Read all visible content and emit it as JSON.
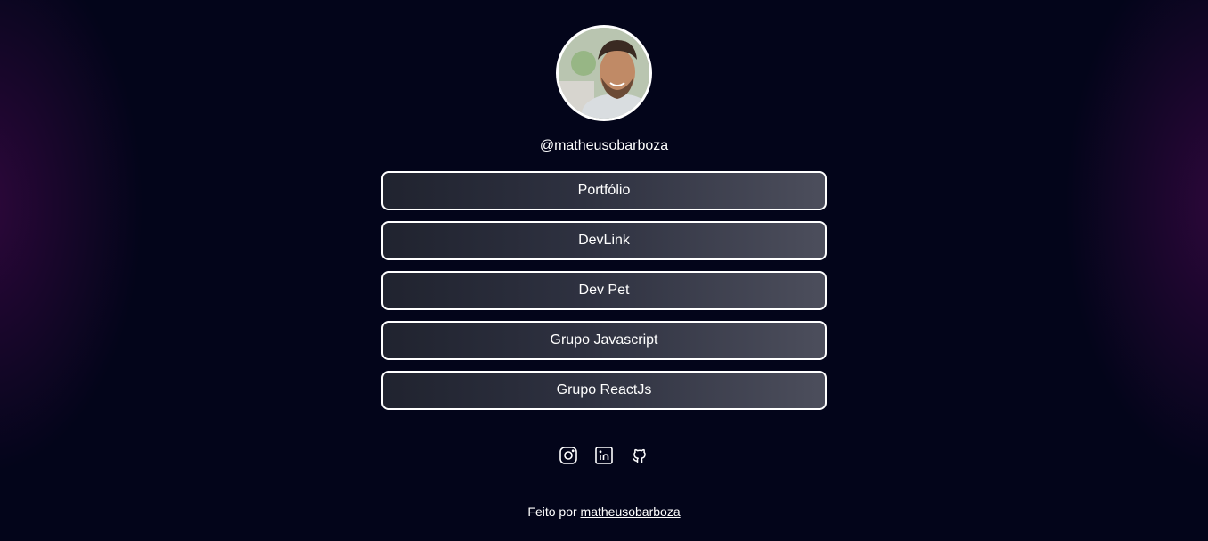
{
  "profile": {
    "username": "@matheusobarboza",
    "avatar_icon": "profile-photo"
  },
  "links": [
    {
      "label": "Portfólio"
    },
    {
      "label": "DevLink"
    },
    {
      "label": "Dev Pet"
    },
    {
      "label": "Grupo Javascript"
    },
    {
      "label": "Grupo ReactJs"
    }
  ],
  "socials": [
    {
      "icon": "instagram-icon"
    },
    {
      "icon": "linkedin-icon"
    },
    {
      "icon": "github-icon"
    }
  ],
  "footer": {
    "prefix": "Feito por",
    "author": "matheusobarboza"
  },
  "colors": {
    "background": "#03051a",
    "glow": "#3c0846",
    "button_start": "#20232f",
    "button_end": "#4c4e5c",
    "border": "#ffffff"
  }
}
